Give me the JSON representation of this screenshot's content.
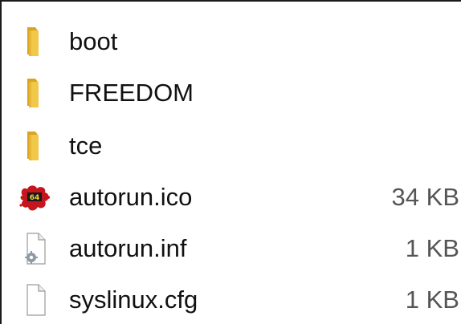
{
  "files": [
    {
      "name": "boot",
      "size": "",
      "icon": "folder-icon"
    },
    {
      "name": "FREEDOM",
      "size": "",
      "icon": "folder-icon"
    },
    {
      "name": "tce",
      "size": "",
      "icon": "folder-icon"
    },
    {
      "name": "autorun.ico",
      "size": "34 KB",
      "icon": "puppy-64-icon"
    },
    {
      "name": "autorun.inf",
      "size": "1 KB",
      "icon": "gear-document-icon"
    },
    {
      "name": "syslinux.cfg",
      "size": "1 KB",
      "icon": "blank-document-icon"
    }
  ],
  "colors": {
    "folder": "#f2c84b",
    "folder_dark": "#d9a520",
    "icon_red": "#c4161c",
    "text": "#111111",
    "size_text": "#555555"
  }
}
